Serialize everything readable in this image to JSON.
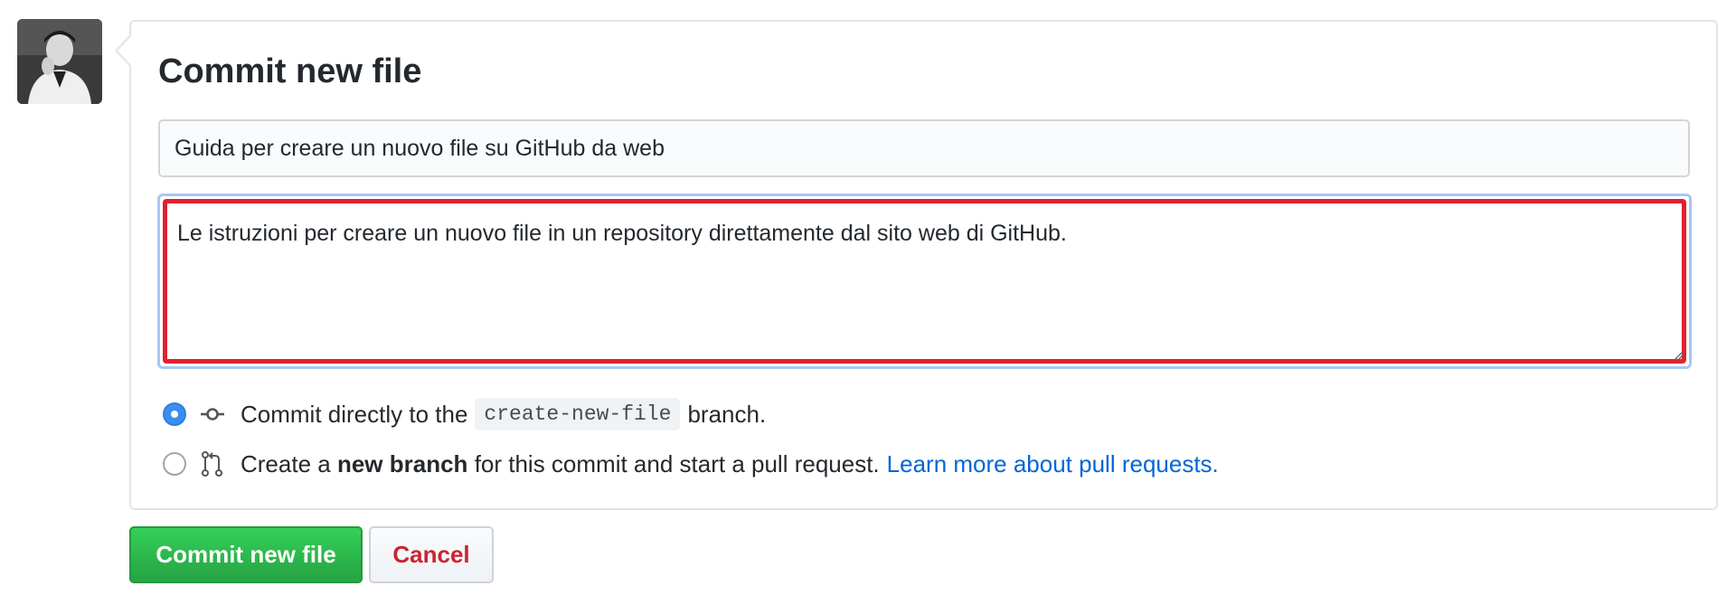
{
  "avatar": {
    "icon": "user-avatar"
  },
  "commit": {
    "title": "Commit new file",
    "summary_value": "Guida per creare un nuovo file su GitHub da web",
    "description_value": "Le istruzioni per creare un nuovo file in un repository direttamente dal sito web di GitHub.",
    "highlight_color": "#e0212e"
  },
  "options": {
    "direct": {
      "selected": true,
      "icon": "git-commit-icon",
      "prefix": "Commit directly to the",
      "branch": "create-new-file",
      "suffix": "branch."
    },
    "new_branch": {
      "selected": false,
      "icon": "git-pull-request-icon",
      "prefix": "Create a",
      "bold": "new branch",
      "suffix": "for this commit and start a pull request.",
      "link": "Learn more about pull requests."
    }
  },
  "buttons": {
    "commit_label": "Commit new file",
    "cancel_label": "Cancel"
  },
  "colors": {
    "accent_blue": "#0366d6",
    "commit_green": "#28a745",
    "cancel_red": "#cb2431"
  }
}
